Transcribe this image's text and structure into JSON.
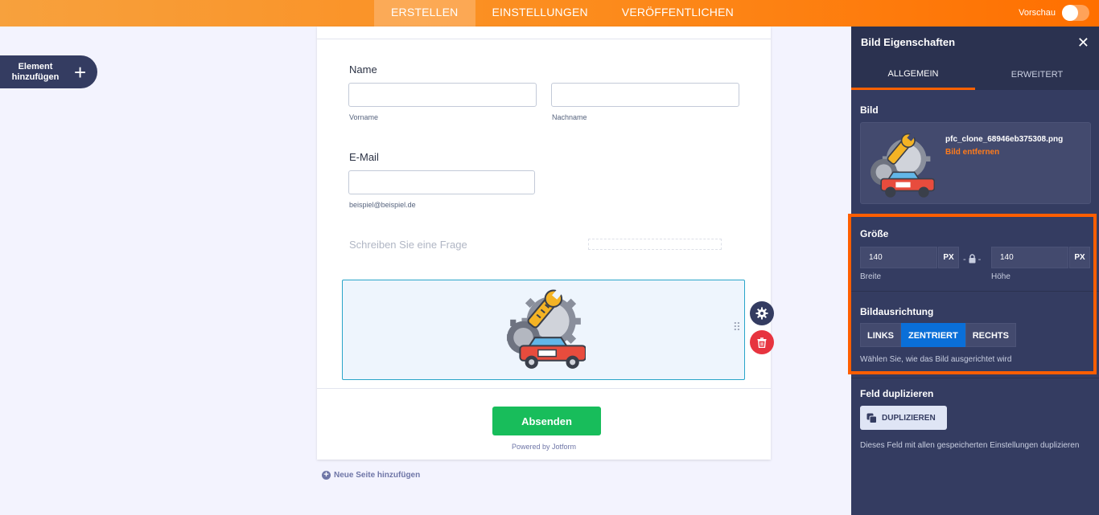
{
  "topbar": {
    "tabs": [
      "ERSTELLEN",
      "EINSTELLUNGEN",
      "VERÖFFENTLICHEN"
    ],
    "preview_label": "Vorschau"
  },
  "sidebar": {
    "add_element": "Element hinzufügen"
  },
  "form": {
    "name_label": "Name",
    "first_sublabel": "Vorname",
    "last_sublabel": "Nachname",
    "email_label": "E-Mail",
    "email_sublabel": "beispiel@beispiel.de",
    "question_placeholder": "Schreiben Sie eine Frage",
    "submit_label": "Absenden",
    "powered_by": "Powered by Jotform",
    "add_page": "Neue Seite hinzufügen"
  },
  "panel": {
    "title": "Bild Eigenschaften",
    "tabs": [
      "ALLGEMEIN",
      "ERWEITERT"
    ],
    "image_section": "Bild",
    "filename": "pfc_clone_68946eb375308.png",
    "remove_label": "Bild entfernen",
    "size_section": "Größe",
    "width_value": "140",
    "height_value": "140",
    "unit": "PX",
    "width_label": "Breite",
    "height_label": "Höhe",
    "align_section": "Bildausrichtung",
    "align_options": [
      "LINKS",
      "ZENTRIERT",
      "RECHTS"
    ],
    "align_selected": "ZENTRIERT",
    "align_hint": "Wählen Sie, wie das Bild ausgerichtet wird",
    "duplicate_section": "Feld duplizieren",
    "duplicate_button": "DUPLIZIEREN",
    "duplicate_hint": "Dieses Feld mit allen gespeicherten Einstellungen duplizieren"
  },
  "colors": {
    "accent": "#ff6100",
    "panel_bg": "#343c61",
    "submit": "#18bd5b",
    "selected": "#0a6fd8",
    "delete": "#e7343f"
  },
  "icons": [
    "plus-icon",
    "gear-icon",
    "trash-icon",
    "close-icon",
    "lock-icon",
    "duplicate-icon",
    "add-page-icon",
    "drag-handle-icon",
    "car-repair-image"
  ]
}
